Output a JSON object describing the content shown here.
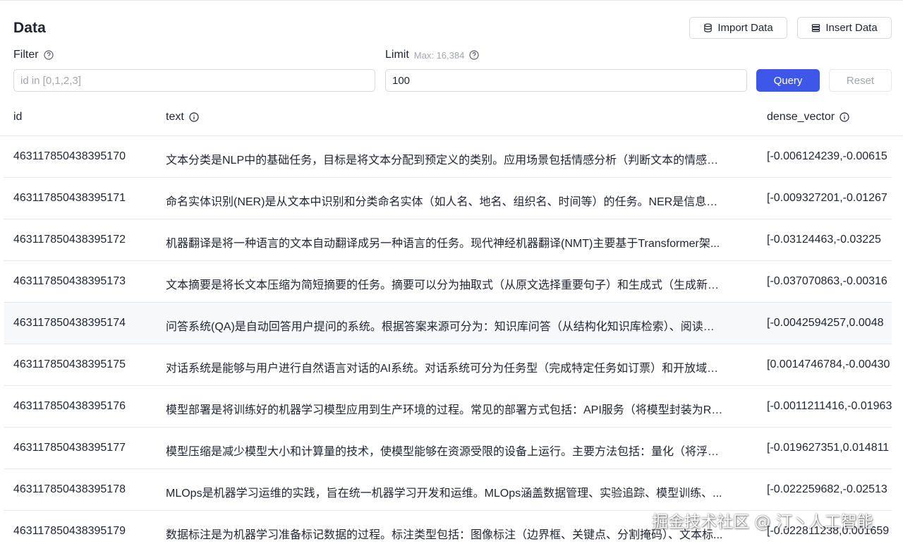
{
  "page": {
    "title": "Data",
    "import_label": "Import Data",
    "insert_label": "Insert Data"
  },
  "filter": {
    "label": "Filter",
    "placeholder": "id in [0,1,2,3]",
    "value": ""
  },
  "limit": {
    "label": "Limit",
    "hint": "Max: 16,384",
    "value": "100"
  },
  "actions": {
    "query_label": "Query",
    "reset_label": "Reset"
  },
  "table": {
    "columns": {
      "id": "id",
      "text": "text",
      "vector": "dense_vector"
    },
    "rows": [
      {
        "id": "463117850438395170",
        "text": "文本分类是NLP中的基础任务，目标是将文本分配到预定义的类别。应用场景包括情感分析（判断文本的情感倾...",
        "vector": "[-0.006124239,-0.00615"
      },
      {
        "id": "463117850438395171",
        "text": "命名实体识别(NER)是从文本中识别和分类命名实体（如人名、地名、组织名、时间等）的任务。NER是信息抽...",
        "vector": "[-0.009327201,-0.01267"
      },
      {
        "id": "463117850438395172",
        "text": "机器翻译是将一种语言的文本自动翻译成另一种语言的任务。现代神经机器翻译(NMT)主要基于Transformer架...",
        "vector": "[-0.03124463,-0.03225"
      },
      {
        "id": "463117850438395173",
        "text": "文本摘要是将长文本压缩为简短摘要的任务。摘要可以分为抽取式（从原文选择重要句子）和生成式（生成新的...",
        "vector": "[-0.037070863,-0.00316"
      },
      {
        "id": "463117850438395174",
        "text": "问答系统(QA)是自动回答用户提问的系统。根据答案来源可分为：知识库问答（从结构化知识库检索）、阅读理...",
        "vector": "[-0.0042594257,0.0048"
      },
      {
        "id": "463117850438395175",
        "text": "对话系统是能够与用户进行自然语言对话的AI系统。对话系统可分为任务型（完成特定任务如订票）和开放域（...",
        "vector": "[0.0014746784,-0.00430"
      },
      {
        "id": "463117850438395176",
        "text": "模型部署是将训练好的机器学习模型应用到生产环境的过程。常见的部署方式包括：API服务（将模型封装为RE...",
        "vector": "[-0.0011211416,-0.01963"
      },
      {
        "id": "463117850438395177",
        "text": "模型压缩是减少模型大小和计算量的技术，使模型能够在资源受限的设备上运行。主要方法包括：量化（将浮点...",
        "vector": "[-0.019627351,0.014811"
      },
      {
        "id": "463117850438395178",
        "text": "MLOps是机器学习运维的实践，旨在统一机器学习开发和运维。MLOps涵盖数据管理、实验追踪、模型训练、...",
        "vector": "[-0.022259682,-0.02513"
      },
      {
        "id": "463117850438395179",
        "text": "数据标注是为机器学习准备标记数据的过程。标注类型包括：图像标注（边界框、关键点、分割掩码）、文本标...",
        "vector": "[-0.022811238,0.001659"
      }
    ]
  },
  "watermark": "掘金技术社区 @ 汀丶人工智能"
}
